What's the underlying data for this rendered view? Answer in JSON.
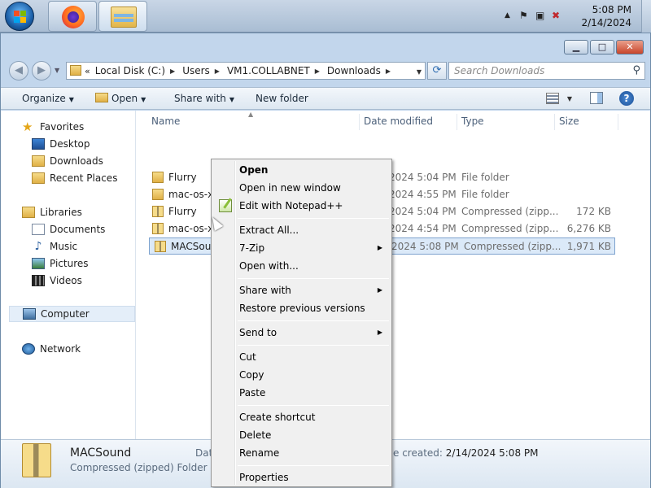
{
  "taskbar": {
    "clock_time": "5:08 PM",
    "clock_date": "2/14/2024",
    "tray_icons": [
      "up-arrow-icon",
      "flag-icon",
      "network-icon",
      "volume-muted-icon"
    ]
  },
  "window": {
    "controls": [
      "minimize",
      "maximize",
      "close"
    ]
  },
  "address": {
    "prefix": "«",
    "crumbs": [
      "Local Disk (C:)",
      "Users",
      "VM1.COLLABNET",
      "Downloads"
    ],
    "search_placeholder": "Search Downloads"
  },
  "toolbar": {
    "organize": "Organize",
    "open": "Open",
    "share_with": "Share with",
    "new_folder": "New folder"
  },
  "sidebar": {
    "favorites": "Favorites",
    "desktop": "Desktop",
    "downloads": "Downloads",
    "recent_places": "Recent Places",
    "libraries": "Libraries",
    "documents": "Documents",
    "music": "Music",
    "pictures": "Pictures",
    "videos": "Videos",
    "computer": "Computer",
    "network": "Network"
  },
  "columns": {
    "name": "Name",
    "date": "Date modified",
    "type": "Type",
    "size": "Size"
  },
  "files": [
    {
      "name": "Flurry",
      "date": "2/14/2024 5:04 PM",
      "type": "File folder",
      "size": "",
      "kind": "folder"
    },
    {
      "name": "mac-os-x-",
      "date": "2/14/2024 4:55 PM",
      "type": "File folder",
      "size": "",
      "kind": "folder"
    },
    {
      "name": "Flurry",
      "date": "2/14/2024 5:04 PM",
      "type": "Compressed (zipp...",
      "size": "172 KB",
      "kind": "zip"
    },
    {
      "name": "mac-os-x-",
      "date": "2/14/2024 4:54 PM",
      "type": "Compressed (zipp...",
      "size": "6,276 KB",
      "kind": "zip"
    },
    {
      "name": "MACSoun",
      "date": "2/14/2024 5:08 PM",
      "type": "Compressed (zipp...",
      "size": "1,971 KB",
      "kind": "zip"
    }
  ],
  "context_menu": {
    "open": "Open",
    "open_new_window": "Open in new window",
    "edit_notepad": "Edit with Notepad++",
    "extract_all": "Extract All...",
    "seven_zip": "7-Zip",
    "open_with": "Open with...",
    "share_with": "Share with",
    "restore_prev": "Restore previous versions",
    "send_to": "Send to",
    "cut": "Cut",
    "copy": "Copy",
    "paste": "Paste",
    "create_shortcut": "Create shortcut",
    "delete": "Delete",
    "rename": "Rename",
    "properties": "Properties"
  },
  "details": {
    "name": "MACSound",
    "type": "Compressed (zipped) Folder",
    "date_label": "Date",
    "created_label": "e created:",
    "created_value": "2/14/2024 5:08 PM"
  }
}
